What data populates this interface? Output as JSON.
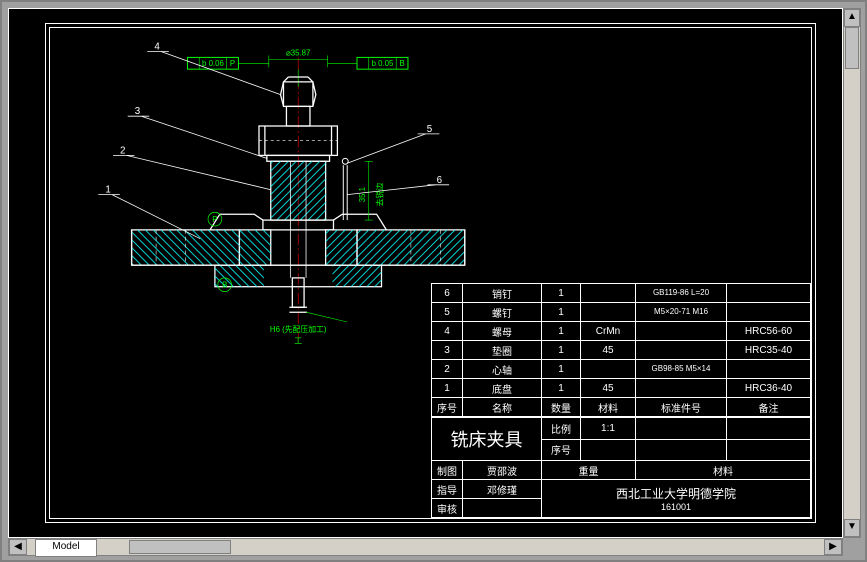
{
  "drawing": {
    "title": "铣床夹具",
    "institution": "西北工业大学明德学院",
    "institution_code": "161001",
    "dimensions": {
      "top_diameter": "⌀35.87",
      "gdt_left_value": "b 0.06",
      "gdt_left_datum": "P",
      "gdt_right_value": "b 0.05",
      "gdt_right_datum": "B",
      "height_right": "35.1",
      "right_note": "去锐边",
      "bottom_note": "H6 (先配压加工)",
      "below_note": "工",
      "datum_p": "P",
      "datum_b": "B"
    },
    "callouts": [
      "1",
      "2",
      "3",
      "4",
      "5",
      "6"
    ]
  },
  "bom": {
    "headers": {
      "index": "序号",
      "name": "名称",
      "qty": "数量",
      "material": "材料",
      "standard": "标准件号",
      "remark": "备注"
    },
    "rows": [
      {
        "idx": "6",
        "name": "销钉",
        "qty": "1",
        "material": "",
        "standard": "GB119-86 L=20",
        "remark": ""
      },
      {
        "idx": "5",
        "name": "螺钉",
        "qty": "1",
        "material": "",
        "standard": "M5×20-71 M16",
        "remark": ""
      },
      {
        "idx": "4",
        "name": "螺母",
        "qty": "1",
        "material": "CrMn",
        "standard": "",
        "remark": "HRC56-60"
      },
      {
        "idx": "3",
        "name": "垫圈",
        "qty": "1",
        "material": "45",
        "standard": "",
        "remark": "HRC35-40"
      },
      {
        "idx": "2",
        "name": "心轴",
        "qty": "1",
        "material": "",
        "standard": "GB98-85 M5×14",
        "remark": ""
      },
      {
        "idx": "1",
        "name": "底盘",
        "qty": "1",
        "material": "45",
        "standard": "",
        "remark": "HRC36-40"
      }
    ]
  },
  "titleblock": {
    "labels": {
      "scale": "比例",
      "scale_value": "1:1",
      "sheet": "序号",
      "weight": "重量",
      "material": "材料",
      "drawn": "制图",
      "checked": "指导",
      "approved": "审核"
    },
    "drawn_by": "贾邵波",
    "checked_by": "邓修瑾",
    "approved_by": ""
  },
  "ui": {
    "tab": "Model"
  }
}
